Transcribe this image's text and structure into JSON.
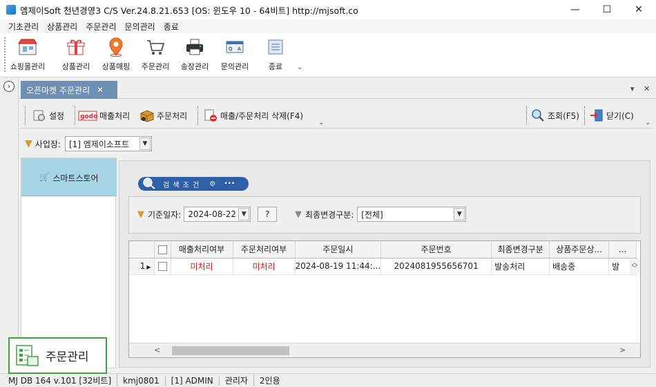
{
  "window": {
    "title": "엠제이Soft 천년경영3 C/S  Ver.24.8.21.653  [OS: 윈도우 10 - 64비트]  http://mjsoft.co",
    "minimize": "—",
    "maximize": "☐",
    "close": "✕"
  },
  "menu": [
    "기초관리",
    "상품관리",
    "주문관리",
    "문의관리",
    "종료"
  ],
  "toolbar": {
    "items": [
      {
        "label": "쇼핑몰관리",
        "icon": "shopping-mall-icon"
      },
      {
        "label": "상품관리",
        "icon": "gift-box-icon"
      },
      {
        "label": "상품매핑",
        "icon": "map-pin-icon"
      },
      {
        "label": "주문관리",
        "icon": "cart-icon"
      },
      {
        "label": "송장관리",
        "icon": "printer-icon"
      },
      {
        "label": "문의관리",
        "icon": "qa-icon"
      },
      {
        "label": "종료",
        "icon": "exit-icon"
      }
    ],
    "overflow": "⌄"
  },
  "tab": {
    "label": "오픈마켓 주문관리",
    "close": "✕",
    "menu_arrow": "▾",
    "close_all": "✕"
  },
  "commands": {
    "settings": "설정",
    "sales": "매출처리",
    "order": "주문처리",
    "delete": "매출/주문처리 삭제(F4)",
    "search": "조회(F5)",
    "close": "닫기(C)",
    "sales_icon_text": "godo",
    "overflow": "⌄"
  },
  "branch": {
    "label": "사업장:",
    "value": "[1] 엠제이소프트"
  },
  "nav": {
    "item": "스마트스토어"
  },
  "search": {
    "badge": "검 색 조 건",
    "more": "•••",
    "date_label": "기준일자:",
    "date_value": "2024-08-22",
    "help_button": "?",
    "change_label": "최종변경구분:",
    "change_value": "[전체]"
  },
  "grid": {
    "columns": [
      "",
      "",
      "매출처리여부",
      "주문처리여부",
      "주문일시",
      "주문번호",
      "최종변경구분",
      "상품주문상...",
      "..."
    ],
    "rows": [
      {
        "num": "1",
        "sales_status": "미처리",
        "order_status": "미처리",
        "order_datetime": "2024-08-19 11:44:...",
        "order_no": "2024081955656701",
        "last_change": "발송처리",
        "item_status": "배송중",
        "extra": "발"
      }
    ],
    "scroll_left": "<",
    "scroll_right": ">"
  },
  "module_badge": "주문관리",
  "status": [
    "MJ DB 164 v.101 [32비트]",
    "kmj0801",
    "[1] ADMIN",
    "관리자",
    "2인용"
  ],
  "colors": {
    "tab_active": "#6e8fb3",
    "nav_selected": "#a7d5e6",
    "search_badge": "#2e5fa7",
    "unprocessed_text": "#e01010",
    "module_border": "#3fa33f"
  }
}
